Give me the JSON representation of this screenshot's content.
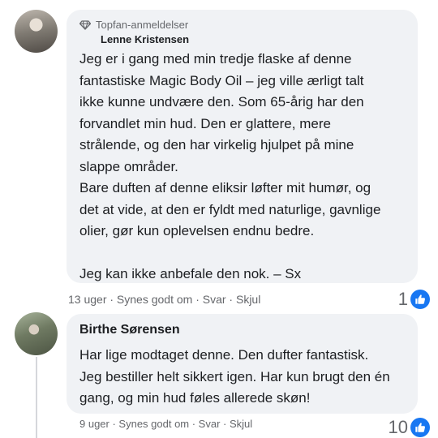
{
  "comments": [
    {
      "badge": "Topfan-anmeldelser",
      "author": "Lenne Kristensen",
      "lines": [
        "Jeg er i gang med min tredje flaske af denne",
        "fantastiske Magic Body Oil – jeg ville ærligt talt",
        "ikke kunne undvære den. Som 65-årig har den",
        "forvandlet min hud. Den er glattere, mere",
        "strålende, og den har virkelig hjulpet på mine",
        "slappe områder.",
        "Bare duften af denne eliksir løfter mit humør, og",
        "det at vide, at den er fyldt med naturlige, gavnlige",
        "olier, gør kun oplevelsen endnu bedre.",
        "",
        "Jeg kan ikke anbefale den nok. – Sx"
      ],
      "meta": "13 uger · Synes godt om · Svar · Skjul",
      "reaction_count": "1"
    },
    {
      "author": "Birthe Sørensen",
      "lines": [
        "Har lige modtaget denne. Den dufter fantastisk.",
        "Jeg bestiller helt sikkert igen. Har kun brugt den én",
        "gang, og min hud føles allerede skøn!"
      ],
      "meta": "9 uger · Synes godt om · Svar · Skjul",
      "reaction_count": "10"
    }
  ],
  "colors": {
    "bubble": "#f0f2f5",
    "like_blue": "#1877f2",
    "meta_gray": "#65676b"
  },
  "icons": {
    "badge": "diamond-icon",
    "reaction": "like-thumb-icon"
  }
}
